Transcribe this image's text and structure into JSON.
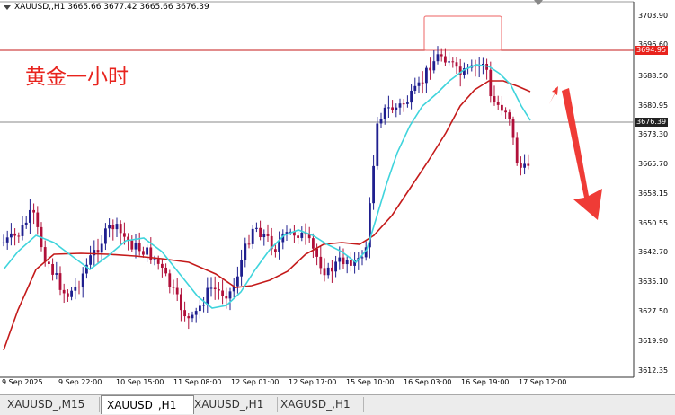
{
  "chart_info": {
    "symbol_line": "XAUUSD,,H1  3665.66 3677.42 3665.66 3676.39"
  },
  "annotation": {
    "label": "黄金一小时"
  },
  "colors": {
    "bull_candle": "#1f1f8f",
    "bear_candle": "#b0103a",
    "fast_ma": "#3fd4dc",
    "slow_ma": "#c41a1a",
    "arrow": "#ef3b36",
    "level_line": "#c41a1a",
    "box": "#f08080"
  },
  "y_axis": {
    "labels": [
      "3703.90",
      "3696.60",
      "3688.50",
      "3680.95",
      "3673.30",
      "3665.70",
      "3658.15",
      "3650.55",
      "3642.70",
      "3635.10",
      "3627.50",
      "3619.90",
      "3612.35"
    ],
    "tag_level": "3694.95",
    "tag_price": "3676.39"
  },
  "x_axis": {
    "labels": [
      "9 Sep 2025",
      "9 Sep 22:00",
      "10 Sep 15:00",
      "11 Sep 08:00",
      "12 Sep 01:00",
      "12 Sep 17:00",
      "15 Sep 10:00",
      "16 Sep 03:00",
      "16 Sep 19:00",
      "17 Sep 12:00"
    ]
  },
  "tabs": [
    "XAUUSD_,M15",
    "XAUUSD_,H1",
    "XAUUSD_,H1",
    "XAGUSD_,H1"
  ],
  "active_tab": 1
}
